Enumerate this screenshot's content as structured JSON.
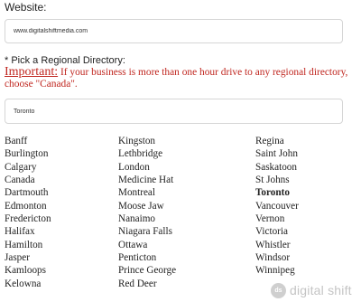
{
  "website": {
    "label": "Website:",
    "value": "www.digitalshiftmedia.com"
  },
  "directory": {
    "label": "* Pick a Regional Directory:",
    "important_prefix": "Important:",
    "important_text": " If your business is more than one hour drive to any regional directory, choose \"Canada\".",
    "value": "Toronto",
    "selected": "Toronto",
    "columns": [
      [
        "Banff",
        "Burlington",
        "Calgary",
        "Canada",
        "Dartmouth",
        "Edmonton",
        "Fredericton",
        "Halifax",
        "Hamilton",
        "Jasper",
        "Kamloops",
        "Kelowna"
      ],
      [
        "Kingston",
        "Lethbridge",
        "London",
        "Medicine Hat",
        "Montreal",
        "Moose Jaw",
        "Nanaimo",
        "Niagara Falls",
        "Ottawa",
        "Penticton",
        "Prince George",
        "Red Deer"
      ],
      [
        "Regina",
        "Saint John",
        "Saskatoon",
        "St Johns",
        "Toronto",
        "Vancouver",
        "Vernon",
        "Victoria",
        "Whistler",
        "Windsor",
        "Winnipeg"
      ]
    ]
  },
  "watermark": {
    "logo_text": "ds",
    "text": "digital shift"
  }
}
